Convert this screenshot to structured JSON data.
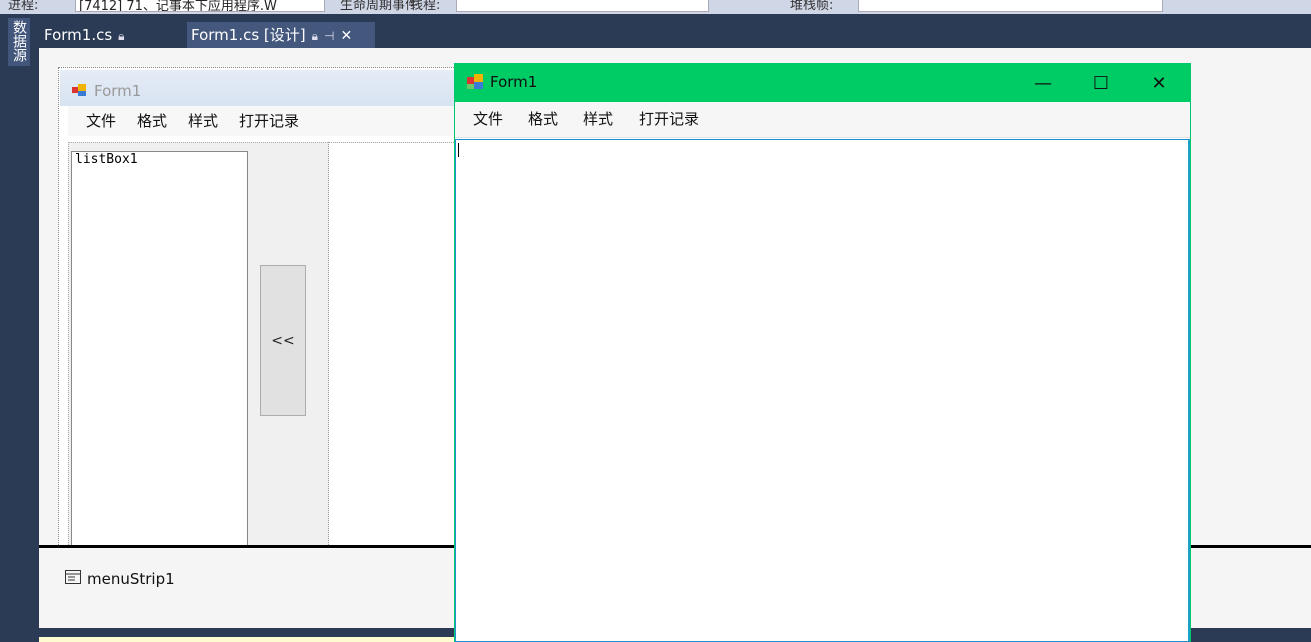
{
  "toolbar": {
    "process_label": "进程:",
    "process_value": "[7412] 71、记事本下应用程序.W",
    "lifecycle_label": "生命周期事件",
    "thread_label": "线程:",
    "stack_label": "堆栈帧:"
  },
  "side_panel": {
    "label": "数据源"
  },
  "tabs": [
    {
      "label": "Form1.cs",
      "icon": "lock-icon"
    },
    {
      "label": "Form1.cs [设计]",
      "icon": "lock-icon",
      "pin": "⊣",
      "close": "✕"
    }
  ],
  "designer": {
    "form_title": "Form1",
    "menu": [
      "文件",
      "格式",
      "样式",
      "打开记录"
    ],
    "listbox_label": "listBox1",
    "button_label": "<<",
    "tray_component": "menuStrip1"
  },
  "running_form": {
    "title": "Form1",
    "menu": [
      "文件",
      "格式",
      "样式",
      "打开记录"
    ],
    "buttons": {
      "minimize": "—",
      "maximize": "☐",
      "close": "✕"
    },
    "title_bar_color": "#00cc66"
  }
}
